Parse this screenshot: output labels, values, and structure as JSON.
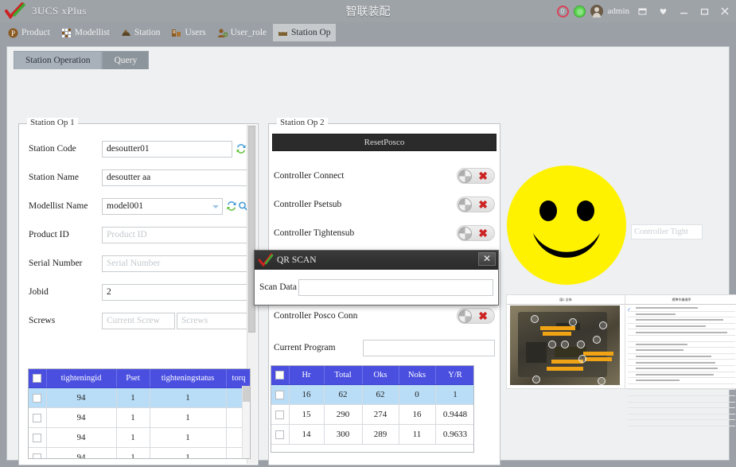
{
  "titlebar": {
    "app_name": "3UCS xPlus",
    "center_title": "智联装配",
    "notif_count": "0",
    "user": "admin",
    "logo_icon": "check-logo-icon",
    "buttons": [
      {
        "name": "restore-window-button",
        "glyph": "❐"
      },
      {
        "name": "pin-button",
        "glyph": "♥"
      },
      {
        "name": "minimize-button",
        "glyph": "—"
      },
      {
        "name": "maximize-button",
        "glyph": "❑"
      },
      {
        "name": "close-button",
        "glyph": "✕"
      }
    ]
  },
  "menubar": {
    "items": [
      {
        "label": "Product",
        "icon": "product-icon",
        "active": false
      },
      {
        "label": "Modellist",
        "icon": "modellist-icon",
        "active": false
      },
      {
        "label": "Station",
        "icon": "station-icon",
        "active": false
      },
      {
        "label": "Users",
        "icon": "users-icon",
        "active": false
      },
      {
        "label": "User_role",
        "icon": "user-role-icon",
        "active": false
      },
      {
        "label": "Station Op",
        "icon": "station-op-icon",
        "active": true
      }
    ]
  },
  "tabs": [
    {
      "label": "Station Operation",
      "selected": false
    },
    {
      "label": "Query",
      "selected": true
    }
  ],
  "station_op_1": {
    "legend": "Station Op 1",
    "fields": [
      {
        "label": "Station Code",
        "value": "desoutter01",
        "placeholder": "",
        "has_refresh": true,
        "has_search": false,
        "type": "text"
      },
      {
        "label": "Station Name",
        "value": "desoutter aa",
        "placeholder": "",
        "has_refresh": false,
        "has_search": false,
        "type": "text"
      },
      {
        "label": "Modellist Name",
        "value": "model001",
        "placeholder": "",
        "has_refresh": true,
        "has_search": true,
        "type": "combo"
      },
      {
        "label": "Product ID",
        "value": "",
        "placeholder": "Product ID",
        "has_refresh": false,
        "has_search": false,
        "type": "text"
      },
      {
        "label": "Serial Number",
        "value": "",
        "placeholder": "Serial Number",
        "has_refresh": false,
        "has_search": false,
        "type": "text"
      },
      {
        "label": "Jobid",
        "value": "2",
        "placeholder": "",
        "has_refresh": false,
        "has_search": false,
        "type": "text"
      }
    ],
    "screws": {
      "label": "Screws",
      "current_value": "",
      "current_placeholder": "Current Screw",
      "total_value": "",
      "total_placeholder": "Screws"
    },
    "extra_field_value": "",
    "grid": {
      "columns": [
        "",
        "tighteningid",
        "Pset",
        "tighteningstatus",
        "torq"
      ],
      "rows": [
        {
          "selected": true,
          "cells": [
            "94",
            "1",
            "1",
            ""
          ]
        },
        {
          "selected": false,
          "cells": [
            "94",
            "1",
            "1",
            ""
          ]
        },
        {
          "selected": false,
          "cells": [
            "94",
            "1",
            "1",
            ""
          ]
        },
        {
          "selected": false,
          "cells": [
            "94",
            "1",
            "1",
            ""
          ]
        }
      ]
    }
  },
  "station_op_2": {
    "legend": "Station Op 2",
    "reset_button": "ResetPosco",
    "toggles": [
      {
        "label": "Controller Connect",
        "state": "off",
        "state_icon": "red-x-icon"
      },
      {
        "label": "Controller Psetsub",
        "state": "off",
        "state_icon": "red-x-icon"
      },
      {
        "label": "Controller Tightensub",
        "state": "off",
        "state_icon": "red-x-icon"
      },
      {
        "label": "Controller Posco Conn",
        "state": "off",
        "state_icon": "red-x-icon"
      }
    ],
    "current_program": {
      "label": "Current Program",
      "value": ""
    },
    "grid": {
      "columns": [
        "",
        "Hr",
        "Total",
        "Oks",
        "Noks",
        "Y/R"
      ],
      "rows": [
        {
          "selected": true,
          "cells": [
            "16",
            "62",
            "62",
            "0",
            "1"
          ]
        },
        {
          "selected": false,
          "cells": [
            "15",
            "290",
            "274",
            "16",
            "0.9448"
          ]
        },
        {
          "selected": false,
          "cells": [
            "14",
            "300",
            "289",
            "11",
            "0.9633"
          ]
        }
      ]
    }
  },
  "right_panel": {
    "status_icon": "smiley-face-icon",
    "status_color": "#FFF200",
    "controller_tight_placeholder": "Controller Tight",
    "work_instruction": {
      "left_header": "図1 全体",
      "right_header": "標準作業順序"
    }
  },
  "qr_dialog": {
    "title": "QR SCAN",
    "logo_icon": "check-logo-icon",
    "close_glyph": "✕",
    "scan_label": "Scan Data",
    "scan_value": "",
    "scan_placeholder": ""
  }
}
